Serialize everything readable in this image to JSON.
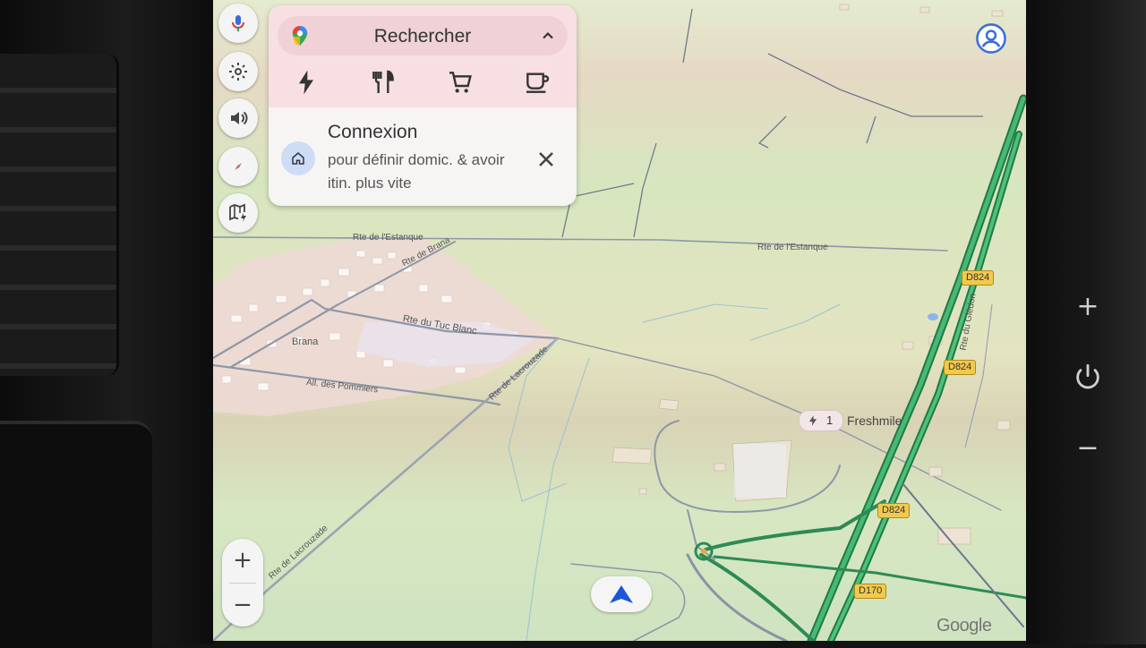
{
  "search": {
    "label": "Rechercher",
    "categories": [
      "charging",
      "restaurants",
      "groceries",
      "coffee"
    ]
  },
  "signin_card": {
    "title": "Connexion",
    "description": "pour définir domic. & avoir itin. plus vite"
  },
  "side_buttons": [
    "microphone-icon",
    "gear-icon",
    "volume-icon",
    "compass-icon",
    "map-layers-icon"
  ],
  "zoom": {
    "in": "+",
    "out": "−"
  },
  "map": {
    "roads": {
      "rte_estanque_1": "Rte de l'Estanque",
      "rte_estanque_2": "Rte de l'Estanque",
      "rte_brana": "Rte de Brana",
      "rte_tuc_blanc": "Rte du Tuc Blanc",
      "brana": "Brana",
      "all_pommiers": "All. des Pommiers",
      "rte_lacrouzade": "Rte de Lacrouzade",
      "rte_lacrouzade_2": "Rte de Lacrouzade",
      "rte_gledon": "Rte du Glédon"
    },
    "shields": {
      "d824_a": "D824",
      "d824_b": "D824",
      "d824_c": "D824",
      "d170": "D170"
    },
    "poi": {
      "count": "1",
      "name": "Freshmile"
    },
    "attribution": "Google"
  },
  "hardware": {
    "plus": "+",
    "minus": "−"
  },
  "colors": {
    "search_top": "#f8dfe2",
    "highway": "#2e9e5e",
    "accent_blue": "#1a57d6"
  }
}
